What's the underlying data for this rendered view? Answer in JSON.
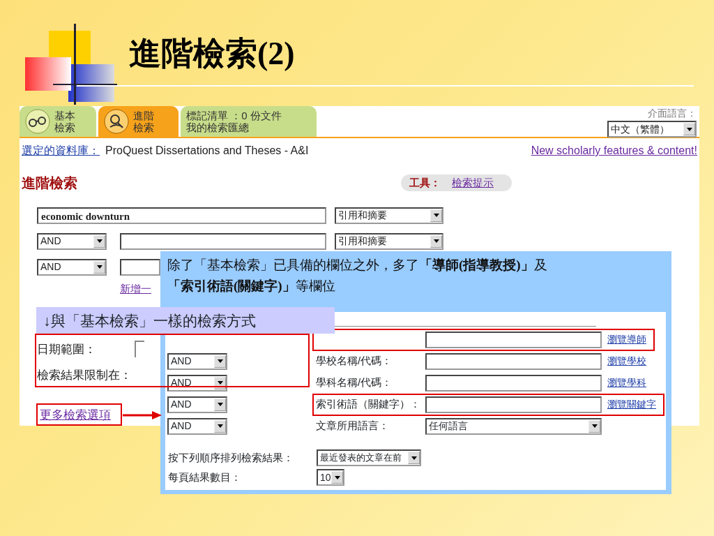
{
  "slide": {
    "title": "進階檢索(2)"
  },
  "site": {
    "tabs": [
      {
        "kind": "glasses",
        "lines": [
          "基本",
          "檢索"
        ],
        "selected": false
      },
      {
        "kind": "magnifier",
        "lines": [
          "進階",
          "檢索"
        ],
        "selected": true
      },
      {
        "kind": "text",
        "lines": [
          "標記清單 ：0 份文件",
          "我的檢索匯總"
        ],
        "selected": false
      }
    ],
    "language_label": "介面語言：",
    "language": "中文（繁體）",
    "database_link": "選定的資料庫：",
    "database": "ProQuest Dissertations and Theses - A&I",
    "news_link": "New scholarly features & content!",
    "heading": "進階檢索",
    "tools_label": "工具：",
    "tools_link": "檢索提示",
    "query_rows": [
      {
        "term": "economic downturn",
        "field": "引用和摘要"
      },
      {
        "operator": "AND",
        "term": "",
        "field": "引用和摘要"
      },
      {
        "operator": "AND",
        "term": ""
      }
    ],
    "add_row_link": "新增一",
    "date_section": {
      "highlighted": true,
      "date_label": "日期範圍：",
      "limit_label": "檢索結果限制在："
    },
    "more_link": {
      "text": "更多檢索選項",
      "highlighted": true
    }
  },
  "more_options": {
    "callout": "除了「基本檢索」已具備的欄位之外，多了**「導師(指導教授)」**及**「索引術語(關鍵字)」**等欄位",
    "rows": [
      {
        "kind": "field",
        "link": "瀏覽導師",
        "highlighted": true
      },
      {
        "kind": "field",
        "operator": "AND",
        "label": "學校名稱/代碼：",
        "link": "瀏覽學校",
        "highlighted": false
      },
      {
        "kind": "field",
        "operator": "AND",
        "label": "學科名稱/代碼：",
        "link": "瀏覽學科",
        "highlighted": false
      },
      {
        "kind": "field",
        "operator": "AND",
        "label": "索引術語（關鍵字）：",
        "link": "瀏覽關鍵字",
        "highlighted": true
      },
      {
        "kind": "select",
        "operator": "AND",
        "label": "文章所用語言：",
        "value": "任何語言",
        "highlighted": false
      }
    ],
    "sort_label": "按下列順序排列檢索結果：",
    "sort_value": "最近發表的文章在前",
    "per_page_label": "每頁結果數目：",
    "per_page_value": "10"
  },
  "note_label": "↓與「基本檢索」一樣的檢索方式"
}
